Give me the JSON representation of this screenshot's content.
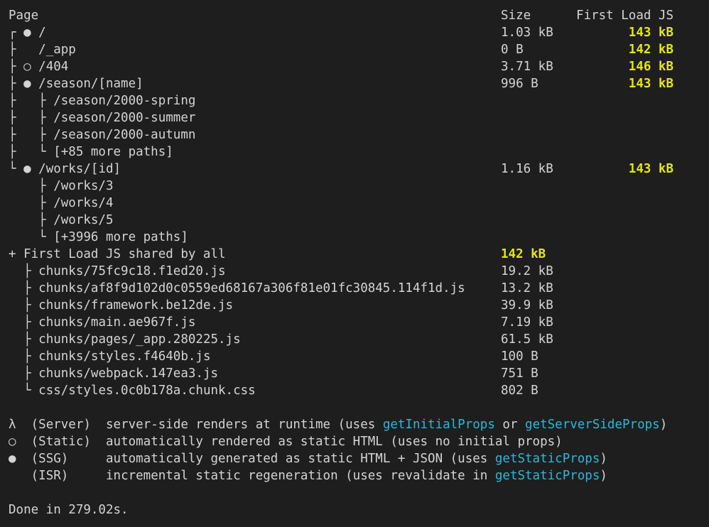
{
  "header": {
    "page": "Page",
    "size": "Size",
    "first_load": "First Load JS"
  },
  "routes": [
    {
      "tree": "┌ ● ",
      "path": "/",
      "size": "1.03 kB",
      "first_load": "143 kB"
    },
    {
      "tree": "├   ",
      "path": "/_app",
      "size": "0 B",
      "first_load": "142 kB"
    },
    {
      "tree": "├ ○ ",
      "path": "/404",
      "size": "3.71 kB",
      "first_load": "146 kB"
    },
    {
      "tree": "├ ● ",
      "path": "/season/[name]",
      "size": "996 B",
      "first_load": "143 kB"
    },
    {
      "tree": "├   ├ ",
      "path": "/season/2000-spring",
      "size": "",
      "first_load": ""
    },
    {
      "tree": "├   ├ ",
      "path": "/season/2000-summer",
      "size": "",
      "first_load": ""
    },
    {
      "tree": "├   ├ ",
      "path": "/season/2000-autumn",
      "size": "",
      "first_load": ""
    },
    {
      "tree": "├   └ ",
      "path": "[+85 more paths]",
      "size": "",
      "first_load": ""
    },
    {
      "tree": "└ ● ",
      "path": "/works/[id]",
      "size": "1.16 kB",
      "first_load": "143 kB"
    },
    {
      "tree": "    ├ ",
      "path": "/works/3",
      "size": "",
      "first_load": ""
    },
    {
      "tree": "    ├ ",
      "path": "/works/4",
      "size": "",
      "first_load": ""
    },
    {
      "tree": "    ├ ",
      "path": "/works/5",
      "size": "",
      "first_load": ""
    },
    {
      "tree": "    └ ",
      "path": "[+3996 more paths]",
      "size": "",
      "first_load": ""
    }
  ],
  "shared": {
    "label": "+ First Load JS shared by all",
    "size": "142 kB",
    "chunks": [
      {
        "tree": "  ├ ",
        "name": "chunks/75fc9c18.f1ed20.js",
        "size": "19.2 kB"
      },
      {
        "tree": "  ├ ",
        "name": "chunks/af8f9d102d0c0559ed68167a306f81e01fc30845.114f1d.js",
        "size": "13.2 kB"
      },
      {
        "tree": "  ├ ",
        "name": "chunks/framework.be12de.js",
        "size": "39.9 kB"
      },
      {
        "tree": "  ├ ",
        "name": "chunks/main.ae967f.js",
        "size": "7.19 kB"
      },
      {
        "tree": "  ├ ",
        "name": "chunks/pages/_app.280225.js",
        "size": "61.5 kB"
      },
      {
        "tree": "  ├ ",
        "name": "chunks/styles.f4640b.js",
        "size": "100 B"
      },
      {
        "tree": "  ├ ",
        "name": "chunks/webpack.147ea3.js",
        "size": "751 B"
      },
      {
        "tree": "  └ ",
        "name": "css/styles.0c0b178a.chunk.css",
        "size": "802 B"
      }
    ]
  },
  "legend": [
    {
      "symbol": "λ",
      "kind": "(Server)",
      "desc_pre": "server-side renders at runtime (uses ",
      "link1": "getInitialProps",
      "mid": " or ",
      "link2": "getServerSideProps",
      "desc_post": ")"
    },
    {
      "symbol": "○",
      "kind": "(Static)",
      "desc_pre": "automatically rendered as static HTML (uses no initial props)",
      "link1": "",
      "mid": "",
      "link2": "",
      "desc_post": ""
    },
    {
      "symbol": "●",
      "kind": "(SSG)",
      "desc_pre": "automatically generated as static HTML + JSON (uses ",
      "link1": "getStaticProps",
      "mid": "",
      "link2": "",
      "desc_post": ")"
    },
    {
      "symbol": " ",
      "kind": "(ISR)",
      "desc_pre": "incremental static regeneration (uses revalidate in ",
      "link1": "getStaticProps",
      "mid": "",
      "link2": "",
      "desc_post": ")"
    }
  ],
  "footer": {
    "done": "Done in 279.02s."
  },
  "colors": {
    "background": "#1e1e1e",
    "text": "#d4d4d4",
    "size_highlight": "#e5e510",
    "link": "#29b8db"
  }
}
